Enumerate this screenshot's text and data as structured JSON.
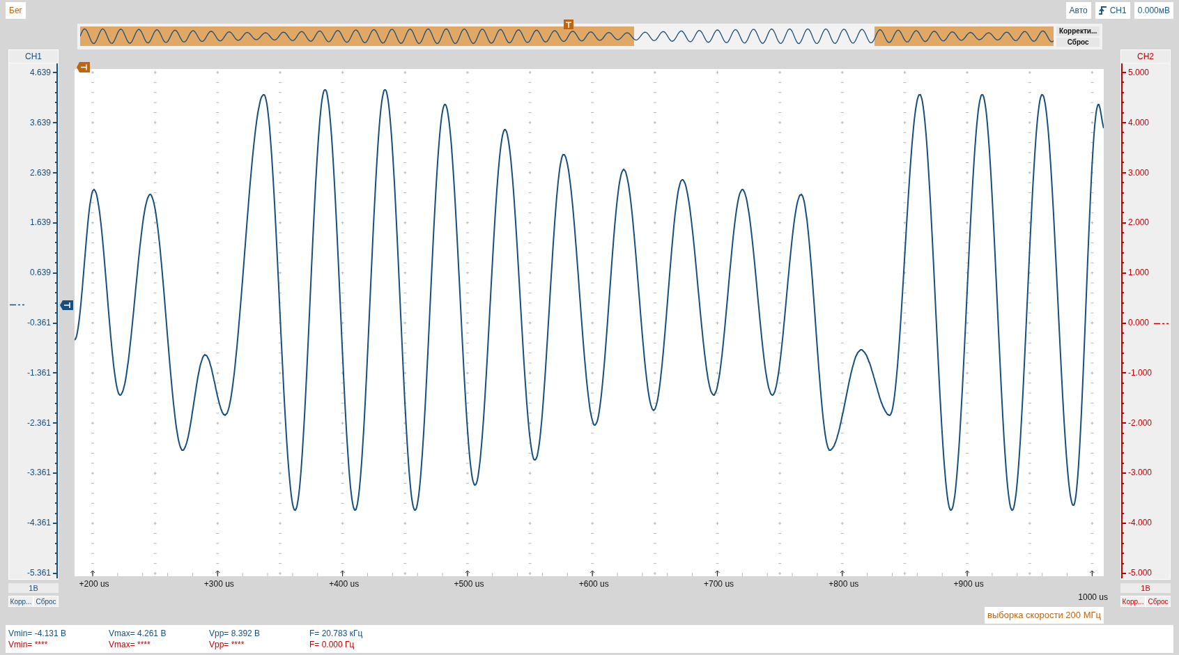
{
  "run_state": "Бег",
  "trigger": {
    "mode": "Авто",
    "source": "CH1",
    "level": "0.000мВ"
  },
  "overview": {
    "buttons": [
      "Корректи...",
      "Сброс"
    ]
  },
  "channels": [
    {
      "name": "CH1",
      "color": "#164f7e",
      "ticks": [
        "4.639",
        "3.639",
        "2.639",
        "1.639",
        "0.639",
        "-0.361",
        "-1.361",
        "-2.361",
        "-3.361",
        "-4.361",
        "-5.361"
      ],
      "scale": "1В",
      "buttons": [
        "Корр...",
        "Сброс"
      ]
    },
    {
      "name": "CH2",
      "color": "#c00000",
      "ticks": [
        "5.000",
        "4.000",
        "3.000",
        "2.000",
        "1.000",
        "0.000",
        "-1.000",
        "-2.000",
        "-3.000",
        "-4.000",
        "-5.000"
      ],
      "scale": "1В",
      "buttons": [
        "Корр...",
        "Сброс"
      ]
    }
  ],
  "time_axis": {
    "ticks": [
      "+200 us",
      "+300 us",
      "+400 us",
      "+500 us",
      "+600 us",
      "+700 us",
      "+800 us",
      "+900 us"
    ],
    "end": "1000 us"
  },
  "sample_rate": "выборка скорости 200 МГц",
  "measurements": [
    [
      "Vmin= -4.131 В",
      "Vmax= 4.261 В",
      "Vpp= 8.392 В",
      "F= 20.783 кГц"
    ],
    [
      "Vmin= ****",
      "Vmax= ****",
      "Vpp= ****",
      "F= 0.000 Гц"
    ]
  ]
}
